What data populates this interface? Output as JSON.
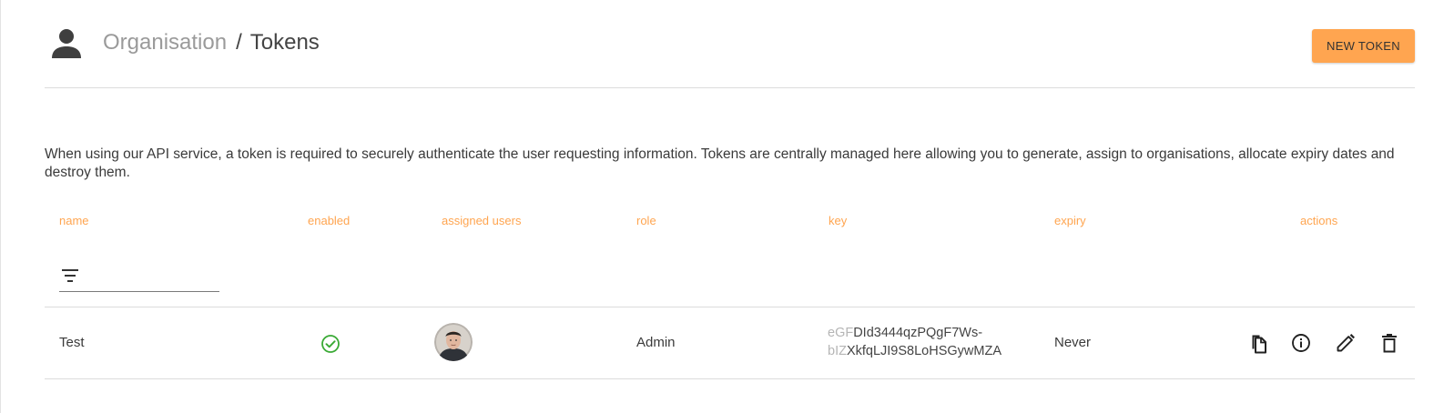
{
  "header": {
    "breadcrumb_parent": "Organisation",
    "breadcrumb_separator": "/",
    "breadcrumb_current": "Tokens",
    "new_token_label": "NEW TOKEN",
    "icon": "person-icon"
  },
  "description": "When using our API service, a token is required to securely authenticate the user requesting information. Tokens are centrally managed here allowing you to generate, assign to organisations, allocate expiry dates and destroy them.",
  "table": {
    "columns": [
      "name",
      "enabled",
      "assigned users",
      "role",
      "key",
      "expiry",
      "actions"
    ],
    "filter": {
      "value": "",
      "icon": "filter-list-icon"
    },
    "rows": [
      {
        "name": "Test",
        "enabled": true,
        "enabled_icon": "check-circle-icon",
        "assigned_users": [
          "user-avatar"
        ],
        "role": "Admin",
        "key_line1_prefix": "eGF",
        "key_line1_rest": "DId3444qzPQgF7Ws-",
        "key_line2_prefix": "bIZ",
        "key_line2_rest": "XkfqLJI9S8LoHSGywMZA",
        "expiry": "Never",
        "actions": [
          "copy-icon",
          "info-icon",
          "edit-icon",
          "delete-icon"
        ]
      }
    ]
  },
  "colors": {
    "accent": "#ffa550",
    "success": "#3aaa35",
    "divider": "#dcdcdc"
  }
}
